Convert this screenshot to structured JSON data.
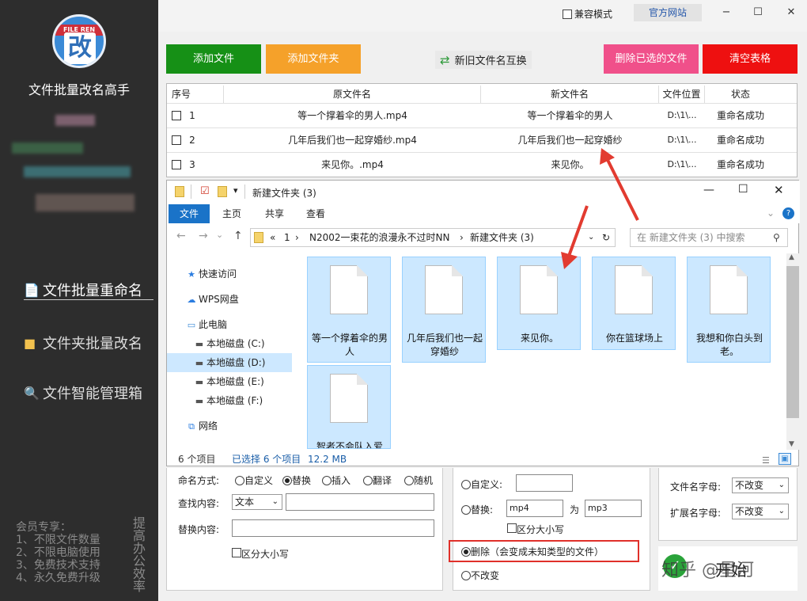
{
  "app": {
    "logo_text": "FILE REN",
    "logo_glyph": "改",
    "title": "文件批量改名高手",
    "nav": [
      "文件批量重命名",
      "文件夹批量改名",
      "文件智能管理箱"
    ],
    "member_lines": [
      "会员专享：",
      "1、不限文件数量",
      "2、不限电脑使用",
      "3、免费技术支持",
      "4、永久免费升级"
    ],
    "vertical_text": "提高办公效率"
  },
  "topbar": {
    "compat_label": "兼容模式",
    "official_label": "官方网站",
    "minimize": "−",
    "maximize": "☐",
    "close": "✕"
  },
  "actions": {
    "add_file": "添加文件",
    "add_folder": "添加文件夹",
    "swap": "新旧文件名互换",
    "delete_selected": "删除已选的文件",
    "clear_table": "清空表格"
  },
  "table": {
    "headers": [
      "序号",
      "原文件名",
      "新文件名",
      "文件位置",
      "状态"
    ],
    "rows": [
      {
        "index": "1",
        "original": "等一个撑着伞的男人.mp4",
        "new": "等一个撑着伞的男人",
        "location": "D:\\1\\...",
        "status": "重命名成功"
      },
      {
        "index": "2",
        "original": "几年后我们也一起穿婚纱.mp4",
        "new": "几年后我们也一起穿婚纱",
        "location": "D:\\1\\...",
        "status": "重命名成功"
      },
      {
        "index": "3",
        "original": "来见你。.mp4",
        "new": "来见你。",
        "location": "D:\\1\\...",
        "status": "重命名成功"
      }
    ]
  },
  "explorer": {
    "title": "新建文件夹 (3)",
    "tabs": [
      "文件",
      "主页",
      "共享",
      "查看"
    ],
    "address": [
      "«",
      "1",
      "›",
      "N2002一束花的浪漫永不过时NN",
      "›",
      "新建文件夹 (3)"
    ],
    "search_placeholder": "在 新建文件夹 (3) 中搜索",
    "tree": [
      "快速访问",
      "WPS网盘",
      "此电脑",
      "本地磁盘 (C:)",
      "本地磁盘 (D:)",
      "本地磁盘 (E:)",
      "本地磁盘 (F:)",
      "网络"
    ],
    "files": [
      "等一个撑着伞的男人",
      "几年后我们也一起穿婚纱",
      "来见你。",
      "你在篮球场上",
      "我想和你白头到老。",
      "智者不会队入爱"
    ],
    "status_count": "6 个项目",
    "status_selected": "已选择 6 个项目",
    "status_size": "12.2 MB"
  },
  "options": {
    "mode_label": "命名方式:",
    "modes": [
      "自定义",
      "替换",
      "插入",
      "翻译",
      "随机"
    ],
    "find_label": "查找内容:",
    "find_type": "文本",
    "replace_label": "替换内容:",
    "case_label": "区分大小写"
  },
  "ext": {
    "custom_label": "自定义:",
    "replace_label": "替换:",
    "replace_from": "mp4",
    "to_label": "为",
    "replace_to": "mp3",
    "case_label": "区分大小写",
    "delete_label": "删除（会变成未知类型的文件）",
    "keep_label": "不改变"
  },
  "letters": {
    "name_label": "文件名字母:",
    "name_value": "不改变",
    "ext_label": "扩展名字母:",
    "ext_value": "不改变"
  },
  "start": {
    "label": "开始",
    "watermark": "知乎 @星河"
  },
  "colors": {
    "green": "#169016",
    "orange": "#f5a12a",
    "pink": "#f0508a",
    "red": "#ee1010",
    "accent": "#1a73c8",
    "arrow": "#e23b30"
  }
}
